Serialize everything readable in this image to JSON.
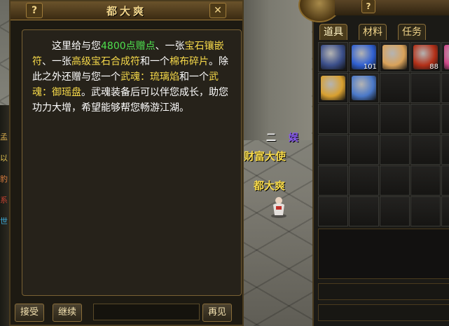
{
  "dialog": {
    "title": "都大爽",
    "help_icon": "?",
    "close_icon": "✕",
    "text": {
      "p1": "这里给与您",
      "points": "4800点赠点",
      "p2": "、一张",
      "gem_card": "宝石镶嵌符",
      "p3": "、一张",
      "gem_merge": "高级宝石合成符",
      "p4": "和一个",
      "cloth": "棉布碎片",
      "p5": "。除此之外还赠与您一个",
      "soul1_label": "武魂：琉璃焰",
      "p6": "和一个",
      "soul2_label": "武魂：御瑶盘",
      "p7": "。武魂装备后可以伴您成长，助您功力大增，希望能够帮您畅游江湖。"
    },
    "buttons": {
      "accept": "接受",
      "continue": "继续",
      "goodbye": "再见"
    }
  },
  "scene": {
    "npc_title": "财富大使",
    "npc_name": "都大爽",
    "frag_er": "二",
    "frag_yu": "娱"
  },
  "inventory": {
    "help_icon": "?",
    "tabs": [
      {
        "label": "道具",
        "active": true
      },
      {
        "label": "材料",
        "active": false
      },
      {
        "label": "任务",
        "active": false
      }
    ],
    "items": [
      {
        "name": "sword-item-icon",
        "count": "",
        "color": "#3b4f8a"
      },
      {
        "name": "blue-orb-item-icon",
        "count": "101",
        "color": "#2f5fd0"
      },
      {
        "name": "pearls-item-icon",
        "count": "",
        "color": "#d9a25a"
      },
      {
        "name": "red-orb-item-icon",
        "count": "88",
        "color": "#b33018"
      },
      {
        "name": "pink-item-icon",
        "count": "",
        "color": "#d04a8a"
      },
      {
        "name": "scroll-item-icon",
        "count": "",
        "color": "#d8a030"
      },
      {
        "name": "blue-charm-item-icon",
        "count": "",
        "color": "#4a78c8"
      }
    ],
    "total_slots": 30
  },
  "colors": {
    "highlight_green": "#4ee04e",
    "highlight_yellow": "#f6d94a",
    "frame_gold": "#a07c3a"
  }
}
